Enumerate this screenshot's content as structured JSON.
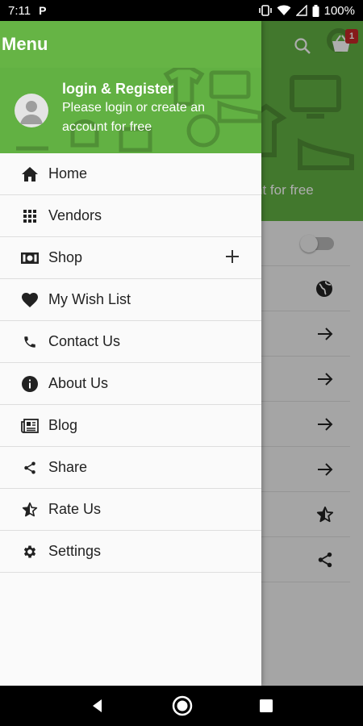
{
  "status_bar": {
    "time": "7:11",
    "notification_icon": "P",
    "battery_percent": "100%"
  },
  "background_screen": {
    "header_subtext": "nt for free",
    "cart_badge_count": "1",
    "accent_color": "#62b143"
  },
  "drawer": {
    "title": "Menu",
    "header": {
      "title": "login & Register",
      "subtitle": "Please login or create an account for free"
    },
    "items": [
      {
        "label": "Home",
        "icon": "home-icon"
      },
      {
        "label": "Vendors",
        "icon": "grid-icon"
      },
      {
        "label": "Shop",
        "icon": "money-icon",
        "expandable": true
      },
      {
        "label": "My Wish List",
        "icon": "heart-icon"
      },
      {
        "label": "Contact Us",
        "icon": "phone-icon"
      },
      {
        "label": "About Us",
        "icon": "info-icon"
      },
      {
        "label": "Blog",
        "icon": "newspaper-icon"
      },
      {
        "label": "Share",
        "icon": "share-icon"
      },
      {
        "label": "Rate Us",
        "icon": "star-half-icon"
      },
      {
        "label": "Settings",
        "icon": "gear-icon"
      }
    ]
  }
}
